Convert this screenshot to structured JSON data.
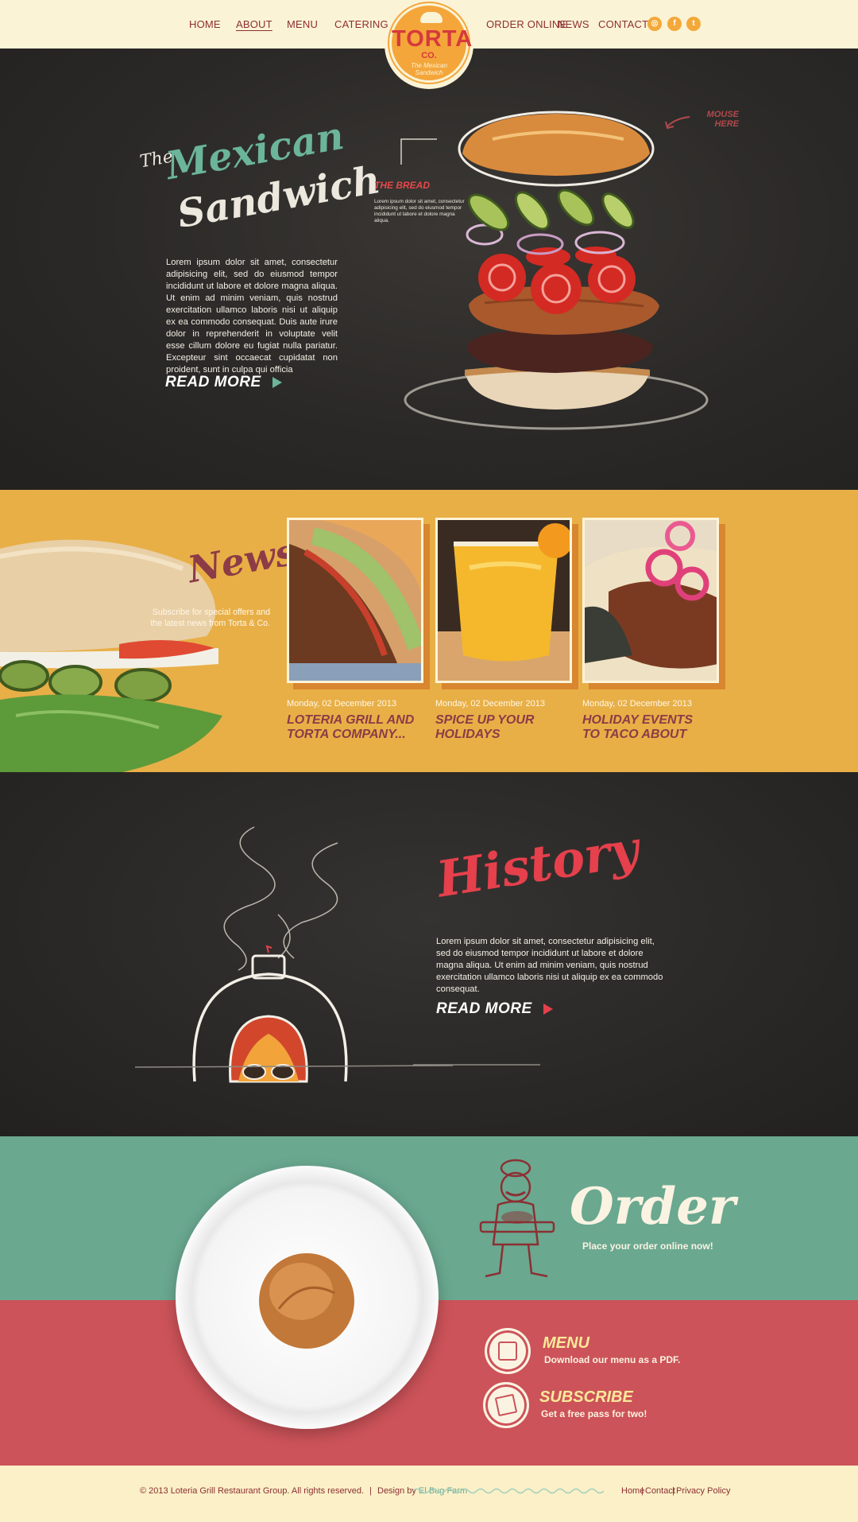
{
  "nav": {
    "left": [
      "HOME",
      "ABOUT",
      "MENU",
      "CATERING"
    ],
    "right": [
      "ORDER ONLINE",
      "NEWS",
      "CONTACT"
    ],
    "active": "ABOUT",
    "social": {
      "instagram": "◎",
      "facebook": "f",
      "twitter": "t"
    }
  },
  "logo": {
    "word": "TORTA",
    "co": "CO.",
    "tagline_1": "The Mexican",
    "tagline_2": "Sandwich"
  },
  "hero": {
    "title_the": "The",
    "title_mexican": "Mexican",
    "title_sandwich": "Sandwich",
    "body": "Lorem ipsum dolor sit amet, consectetur adipisicing elit, sed do eiusmod tempor incididunt ut labore et dolore magna aliqua. Ut enim ad minim veniam, quis nostrud exercitation ullamco laboris nisi ut aliquip ex ea commodo consequat. Duis aute irure dolor in reprehenderit in voluptate velit esse cillum dolore eu fugiat nulla pariatur. Excepteur sint occaecat cupidatat non proident, sunt in culpa qui officia",
    "read_more": "READ MORE",
    "bread_title": "THE BREAD",
    "bread_body": "Lorem ipsum dolor sit amet, consectetur adipisicing elit, sed do eiusmod tempor incididunt ut labore et dolore magna aliqua.",
    "mouse_hint_1": "MOUSE",
    "mouse_hint_2": "HERE"
  },
  "news": {
    "title": "News",
    "subtitle": "Subscribe for special offers and the latest news from Torta & Co.",
    "items": [
      {
        "date": "Monday, 02 December 2013",
        "headline": "LOTERIA GRILL AND TORTA COMPANY..."
      },
      {
        "date": "Monday, 02 December 2013",
        "headline": "SPICE UP YOUR HOLIDAYS"
      },
      {
        "date": "Monday, 02 December 2013",
        "headline": "HOLIDAY EVENTS TO TACO ABOUT"
      }
    ]
  },
  "history": {
    "title": "History",
    "body": "Lorem ipsum dolor sit amet, consectetur adipisicing elit, sed do eiusmod tempor incididunt ut labore et dolore magna aliqua. Ut enim ad minim veniam, quis nostrud exercitation ullamco laboris nisi ut aliquip ex ea commodo consequat.",
    "read_more": "READ MORE"
  },
  "order": {
    "title": "Order",
    "subtitle": "Place your order online now!",
    "menu_title": "MENU",
    "menu_sub": "Download our menu as a PDF.",
    "subscribe_title": "SUBSCRIBE",
    "subscribe_sub": "Get a free pass for two!"
  },
  "footer": {
    "copyright": "© 2013 Loteria Grill Restaurant Group. All rights reserved.",
    "separator": "|",
    "design_by": "Design by",
    "design_link": "El Bug Farm",
    "links": [
      "Home",
      "Contact",
      "Privacy Policy"
    ]
  },
  "colors": {
    "header_bg": "#fbf3d6",
    "nav_text": "#8c2f33",
    "accent_orange": "#f4a63a",
    "accent_red": "#e5404c",
    "mint": "#6aa890",
    "news_bg": "#e8af47",
    "order_red": "#cc5359",
    "dark_bg": "#2a2826"
  }
}
